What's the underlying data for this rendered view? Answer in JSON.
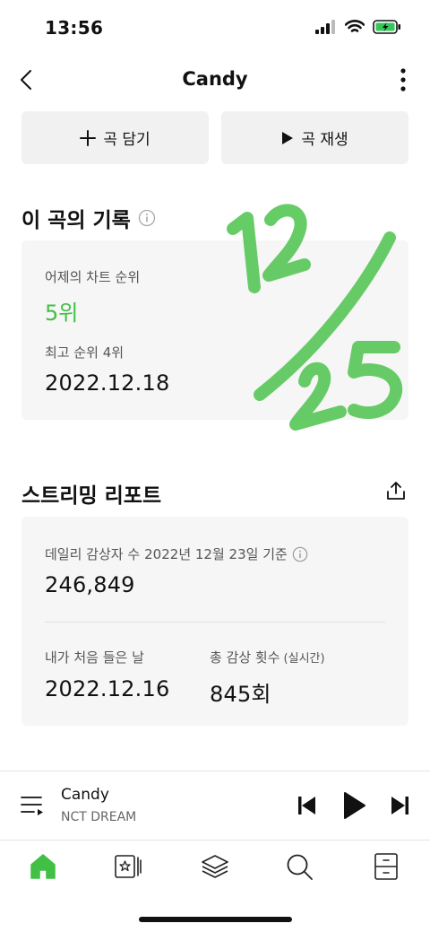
{
  "status_bar": {
    "time": "13:56"
  },
  "header": {
    "title": "Candy"
  },
  "actions": {
    "add_label": "곡 담기",
    "play_label": "곡 재생"
  },
  "song_record": {
    "title": "이 곡의 기록",
    "yesterday_rank_label": "어제의 차트 순위",
    "yesterday_rank_value": "5위",
    "best_rank_label": "최고 순위 4위",
    "best_rank_date": "2022.12.18"
  },
  "handwritten_note": "12/25",
  "streaming_report": {
    "title": "스트리밍 리포트",
    "daily_listeners_label": "데일리 감상자 수",
    "daily_listeners_basis": "2022년 12월 23일 기준",
    "daily_listeners_value": "246,849",
    "first_listen_label": "내가 처음 들은 날",
    "first_listen_value": "2022.12.16",
    "total_plays_label": "총 감상 횟수",
    "total_plays_note": "(실시간)",
    "total_plays_value": "845회"
  },
  "now_playing": {
    "title": "Candy",
    "artist": "NCT DREAM"
  },
  "colors": {
    "accent_green": "#41c045",
    "card_bg": "#f6f6f6",
    "button_bg": "#f1f1f1"
  }
}
